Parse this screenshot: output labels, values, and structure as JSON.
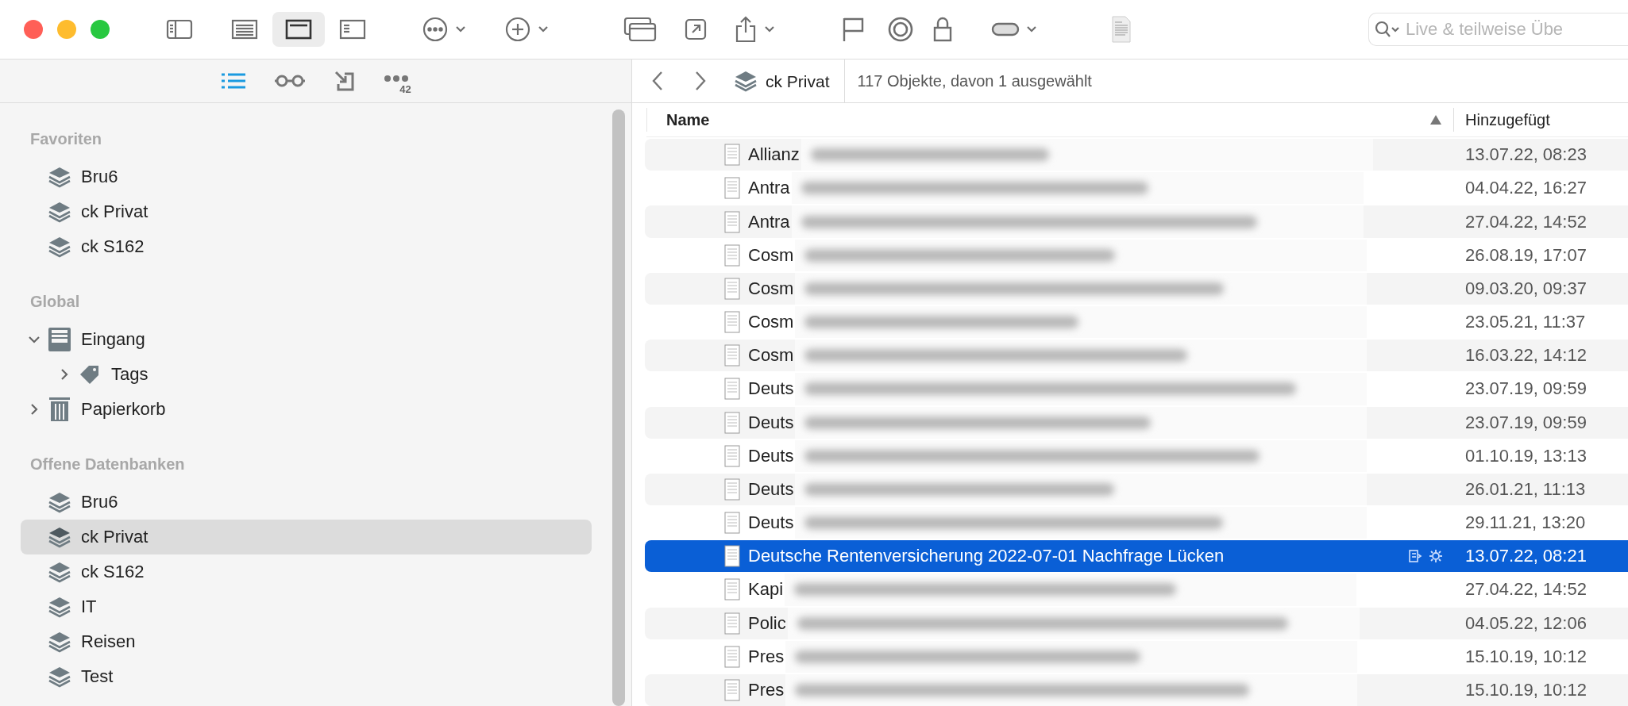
{
  "toolbar": {
    "views": [
      {
        "kind": "sidebar",
        "selected": false
      },
      {
        "kind": "list",
        "selected": false
      },
      {
        "kind": "split",
        "selected": true
      },
      {
        "kind": "preview",
        "selected": false
      }
    ],
    "actions": [
      {
        "kind": "more",
        "menu": true
      },
      {
        "kind": "add",
        "menu": true
      },
      {
        "kind": "windows",
        "menu": false
      },
      {
        "kind": "open",
        "menu": false
      },
      {
        "kind": "share",
        "menu": true
      },
      {
        "kind": "flag",
        "menu": false
      },
      {
        "kind": "ring",
        "menu": false
      },
      {
        "kind": "lock",
        "menu": false
      },
      {
        "kind": "pill",
        "menu": true
      },
      {
        "kind": "document",
        "menu": false
      }
    ],
    "search": {
      "placeholder": "Live & teilweise Übe"
    }
  },
  "sidebar_tabs": [
    {
      "kind": "list",
      "selected": true
    },
    {
      "kind": "glasses",
      "selected": false
    },
    {
      "kind": "import",
      "selected": false
    },
    {
      "kind": "more",
      "selected": false,
      "badge": "42"
    }
  ],
  "sidebar": {
    "sections": [
      {
        "title": "Favoriten",
        "items": [
          {
            "label": "Bru6",
            "kind": "database",
            "selected": false
          },
          {
            "label": "ck Privat",
            "kind": "database",
            "selected": false
          },
          {
            "label": "ck S162",
            "kind": "database",
            "selected": false
          }
        ]
      },
      {
        "title": "Global",
        "items": [
          {
            "label": "Eingang",
            "kind": "inbox",
            "selected": false,
            "expanded": true,
            "children": [
              {
                "label": "Tags",
                "kind": "tag",
                "selected": false,
                "expanded": false
              }
            ]
          },
          {
            "label": "Papierkorb",
            "kind": "trash",
            "selected": false,
            "expanded": false
          }
        ]
      },
      {
        "title": "Offene Datenbanken",
        "items": [
          {
            "label": "Bru6",
            "kind": "database",
            "selected": false
          },
          {
            "label": "ck Privat",
            "kind": "database",
            "selected": true
          },
          {
            "label": "ck S162",
            "kind": "database",
            "selected": false
          },
          {
            "label": "IT",
            "kind": "database",
            "selected": false
          },
          {
            "label": "Reisen",
            "kind": "database",
            "selected": false
          },
          {
            "label": "Test",
            "kind": "database",
            "selected": false
          }
        ]
      }
    ]
  },
  "pathbar": {
    "location": "ck Privat",
    "status": "117 Objekte, davon 1 ausgewählt"
  },
  "table": {
    "columns": [
      {
        "label": "Name"
      },
      {
        "label": "Hinzugefügt"
      }
    ],
    "rows": [
      {
        "name": "Allianz",
        "added": "13.07.22, 08:23",
        "selected": false,
        "blurred": true
      },
      {
        "name": "Antra",
        "added": "04.04.22, 16:27",
        "selected": false,
        "blurred": true
      },
      {
        "name": "Antra",
        "added": "27.04.22, 14:52",
        "selected": false,
        "blurred": true
      },
      {
        "name": "Cosm",
        "added": "26.08.19, 17:07",
        "selected": false,
        "blurred": true
      },
      {
        "name": "Cosm",
        "added": "09.03.20, 09:37",
        "selected": false,
        "blurred": true
      },
      {
        "name": "Cosm",
        "added": "23.05.21, 11:37",
        "selected": false,
        "blurred": true
      },
      {
        "name": "Cosm",
        "added": "16.03.22, 14:12",
        "selected": false,
        "blurred": true
      },
      {
        "name": "Deuts",
        "added": "23.07.19, 09:59",
        "selected": false,
        "blurred": true
      },
      {
        "name": "Deuts",
        "added": "23.07.19, 09:59",
        "selected": false,
        "blurred": true
      },
      {
        "name": "Deuts",
        "added": "01.10.19, 13:13",
        "selected": false,
        "blurred": true
      },
      {
        "name": "Deuts",
        "added": "26.01.21, 11:13",
        "selected": false,
        "blurred": true
      },
      {
        "name": "Deuts",
        "added": "29.11.21, 13:20",
        "selected": false,
        "blurred": true
      },
      {
        "name": "Deutsche Rentenversicherung 2022-07-01 Nachfrage Lücken",
        "added": "13.07.22, 08:21",
        "selected": true,
        "blurred": false
      },
      {
        "name": "Kapi",
        "added": "27.04.22, 14:52",
        "selected": false,
        "blurred": true
      },
      {
        "name": "Polic",
        "added": "04.05.22, 12:06",
        "selected": false,
        "blurred": true
      },
      {
        "name": "Pres",
        "added": "15.10.19, 10:12",
        "selected": false,
        "blurred": true
      },
      {
        "name": "Pres",
        "added": "15.10.19, 10:12",
        "selected": false,
        "blurred": true
      }
    ]
  }
}
